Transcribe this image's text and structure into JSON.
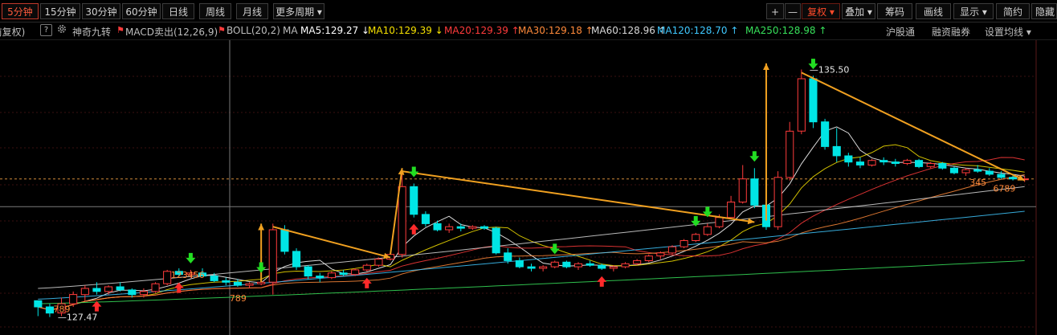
{
  "toolbar": {
    "periods": [
      "5分钟",
      "15分钟",
      "30分钟",
      "60分钟",
      "日线",
      "周线",
      "月线",
      "更多周期 ▾"
    ],
    "active_period": "5分钟",
    "zoom_in": "+",
    "zoom_out": "—",
    "fq": "复权 ▾",
    "overlay": "叠加 ▾",
    "chips": "筹码",
    "draw": "画线",
    "show": "显示 ▾",
    "simple": "简约",
    "hide": "隐藏"
  },
  "indicator_bar": {
    "fq_state": "(前复权)",
    "help_icon": "?",
    "gear_icon": "gear-icon",
    "items": [
      {
        "label": "神奇九转",
        "color": "#bdbdbd"
      },
      {
        "label": "MACD卖出(12,26,9)",
        "color": "#bdbdbd",
        "mark": "⚑"
      },
      {
        "label": "BOLL(20,2)",
        "color": "#bdbdbd",
        "mark": "⚑"
      },
      {
        "label": "MA",
        "color": "#bdbdbd"
      }
    ],
    "ma": [
      {
        "label": "MA5:129.27",
        "arrow": "↓",
        "color": "#ffffff"
      },
      {
        "label": "MA10:129.39",
        "arrow": "↓",
        "color": "#f5e000"
      },
      {
        "label": "MA20:129.39",
        "arrow": "↑",
        "color": "#ff3b3b"
      },
      {
        "label": "MA30:129.18",
        "arrow": "↑",
        "color": "#ff8a3a"
      },
      {
        "label": "MA60:128.96",
        "arrow": "↑",
        "color": "#d8d8d8"
      },
      {
        "label": "MA120:128.70",
        "arrow": "↑",
        "color": "#3fc8ff"
      },
      {
        "label": "MA250:128.98",
        "arrow": "↑",
        "color": "#37e05a"
      }
    ],
    "right_links": [
      "沪股通",
      "融资融券",
      "设置均线 ▾"
    ]
  },
  "chart_data": {
    "type": "candlestick",
    "interval": "5分钟",
    "ylim": [
      127.2,
      135.8
    ],
    "high_label": "135.50",
    "low_label": "127.47",
    "candles": [
      [
        128.0,
        128.0,
        127.5,
        127.8
      ],
      [
        127.8,
        127.9,
        127.47,
        127.6
      ],
      [
        127.6,
        128.1,
        127.5,
        127.9
      ],
      [
        127.9,
        128.3,
        127.8,
        128.2
      ],
      [
        128.2,
        128.5,
        128.0,
        128.4
      ],
      [
        128.4,
        128.6,
        128.2,
        128.3
      ],
      [
        128.3,
        128.5,
        128.2,
        128.45
      ],
      [
        128.45,
        128.6,
        128.3,
        128.35
      ],
      [
        128.35,
        128.4,
        128.1,
        128.2
      ],
      [
        128.2,
        128.4,
        128.1,
        128.3
      ],
      [
        128.3,
        128.6,
        128.25,
        128.55
      ],
      [
        128.55,
        129.0,
        128.5,
        128.95
      ],
      [
        128.95,
        129.05,
        128.8,
        128.85
      ],
      [
        128.85,
        129.0,
        128.75,
        128.9
      ],
      [
        128.9,
        129.05,
        128.8,
        128.8
      ],
      [
        128.8,
        128.9,
        128.6,
        128.65
      ],
      [
        128.65,
        128.75,
        128.5,
        128.6
      ],
      [
        128.6,
        128.7,
        128.45,
        128.5
      ],
      [
        128.5,
        128.6,
        128.4,
        128.55
      ],
      [
        128.55,
        128.7,
        128.5,
        128.6
      ],
      [
        128.6,
        130.5,
        128.2,
        130.3
      ],
      [
        130.3,
        130.45,
        129.5,
        129.6
      ],
      [
        129.6,
        129.7,
        129.0,
        129.1
      ],
      [
        129.1,
        129.15,
        128.7,
        128.8
      ],
      [
        128.8,
        128.9,
        128.6,
        128.75
      ],
      [
        128.75,
        128.95,
        128.7,
        128.9
      ],
      [
        128.9,
        129.0,
        128.8,
        128.85
      ],
      [
        128.85,
        129.05,
        128.8,
        129.0
      ],
      [
        129.0,
        129.2,
        128.95,
        129.15
      ],
      [
        129.15,
        129.4,
        129.1,
        129.35
      ],
      [
        129.35,
        129.6,
        129.3,
        129.5
      ],
      [
        129.5,
        132.2,
        129.4,
        131.7
      ],
      [
        131.7,
        131.8,
        130.7,
        130.8
      ],
      [
        130.8,
        130.9,
        130.4,
        130.5
      ],
      [
        130.5,
        130.6,
        130.25,
        130.3
      ],
      [
        130.3,
        130.5,
        130.2,
        130.4
      ],
      [
        130.4,
        130.5,
        130.25,
        130.35
      ],
      [
        130.35,
        130.45,
        130.3,
        130.4
      ],
      [
        130.4,
        130.45,
        130.3,
        130.35
      ],
      [
        130.35,
        130.4,
        129.5,
        129.55
      ],
      [
        129.55,
        129.7,
        129.2,
        129.3
      ],
      [
        129.3,
        129.4,
        129.05,
        129.1
      ],
      [
        129.1,
        129.2,
        128.95,
        129.05
      ],
      [
        129.05,
        129.15,
        128.95,
        129.1
      ],
      [
        129.1,
        129.3,
        129.05,
        129.25
      ],
      [
        129.25,
        129.3,
        129.05,
        129.1
      ],
      [
        129.1,
        129.25,
        129.0,
        129.2
      ],
      [
        129.2,
        129.3,
        129.1,
        129.15
      ],
      [
        129.15,
        129.2,
        129.0,
        129.05
      ],
      [
        129.05,
        129.15,
        128.95,
        129.1
      ],
      [
        129.1,
        129.25,
        129.05,
        129.2
      ],
      [
        129.2,
        129.35,
        129.15,
        129.3
      ],
      [
        129.3,
        129.5,
        129.25,
        129.45
      ],
      [
        129.45,
        129.6,
        129.35,
        129.55
      ],
      [
        129.55,
        129.8,
        129.5,
        129.75
      ],
      [
        129.75,
        130.0,
        129.7,
        129.95
      ],
      [
        129.95,
        130.2,
        129.9,
        130.15
      ],
      [
        130.15,
        130.5,
        130.1,
        130.4
      ],
      [
        130.4,
        130.8,
        130.35,
        130.7
      ],
      [
        130.7,
        131.4,
        130.65,
        131.2
      ],
      [
        131.2,
        132.4,
        131.15,
        131.95
      ],
      [
        131.95,
        132.3,
        131.0,
        131.1
      ],
      [
        131.1,
        131.2,
        130.3,
        130.4
      ],
      [
        130.4,
        132.2,
        130.3,
        132.0
      ],
      [
        132.0,
        133.8,
        131.9,
        133.5
      ],
      [
        133.5,
        135.5,
        133.4,
        135.2
      ],
      [
        135.2,
        135.3,
        133.6,
        133.8
      ],
      [
        133.8,
        133.9,
        132.9,
        133.0
      ],
      [
        133.0,
        133.6,
        132.5,
        132.7
      ],
      [
        132.7,
        132.8,
        132.35,
        132.5
      ],
      [
        132.5,
        132.65,
        132.3,
        132.4
      ],
      [
        132.4,
        132.6,
        132.35,
        132.55
      ],
      [
        132.55,
        132.65,
        132.4,
        132.5
      ],
      [
        132.5,
        132.6,
        132.35,
        132.45
      ],
      [
        132.45,
        132.6,
        132.4,
        132.55
      ],
      [
        132.55,
        132.6,
        132.3,
        132.35
      ],
      [
        132.35,
        132.5,
        132.3,
        132.45
      ],
      [
        132.45,
        132.5,
        132.25,
        132.3
      ],
      [
        132.3,
        132.35,
        132.1,
        132.15
      ],
      [
        132.15,
        132.3,
        132.05,
        132.25
      ],
      [
        132.25,
        132.4,
        132.15,
        132.2
      ],
      [
        132.2,
        132.3,
        132.05,
        132.1
      ],
      [
        132.1,
        132.2,
        131.95,
        132.0
      ],
      [
        132.0,
        132.1,
        131.9,
        131.95
      ],
      [
        131.95,
        132.05,
        131.85,
        131.95
      ]
    ],
    "signals": {
      "buy": [
        5,
        12,
        28,
        32,
        48
      ],
      "sell": [
        13,
        19,
        32,
        44,
        56,
        57,
        61,
        66
      ]
    },
    "nine_turn_labels": [
      {
        "text": "789",
        "color": "#ff8a3a"
      },
      {
        "text": "123456",
        "color": "#ff8a3a"
      },
      {
        "text": "789",
        "color": "#ff8a3a"
      },
      {
        "text": "345",
        "color": "#ff8a3a"
      },
      {
        "text": "6789",
        "color": "#ff8a3a"
      }
    ],
    "ma_lines": [
      {
        "name": "MA5",
        "color": "#ffffff"
      },
      {
        "name": "MA10",
        "color": "#f5e000"
      },
      {
        "name": "MA20",
        "color": "#ff3b3b"
      },
      {
        "name": "MA30",
        "color": "#ff8a3a"
      },
      {
        "name": "MA60",
        "color": "#d8d8d8"
      },
      {
        "name": "MA120",
        "color": "#3fc8ff"
      },
      {
        "name": "MA250",
        "color": "#37e05a"
      }
    ],
    "up_color": "#ff3b3b",
    "down_color": "#00e5e5",
    "trend_color": "#f0a020"
  }
}
